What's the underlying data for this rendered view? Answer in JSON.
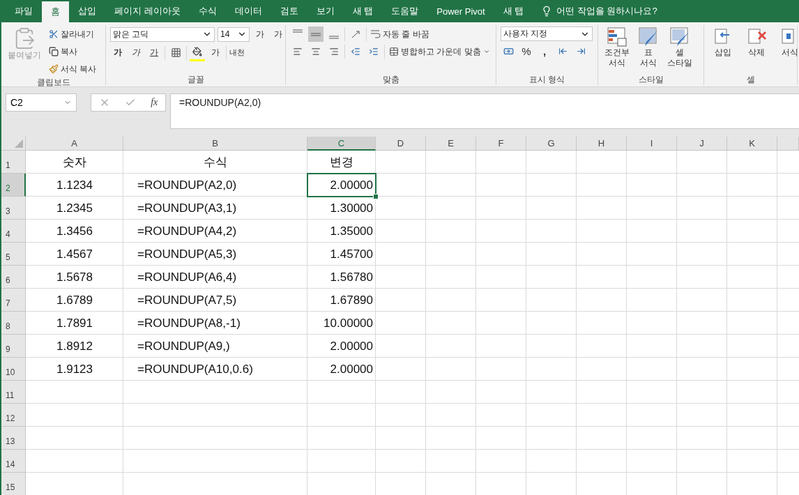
{
  "tabs": [
    {
      "label": "파일",
      "selected": false
    },
    {
      "label": "홈",
      "selected": true
    },
    {
      "label": "삽입",
      "selected": false
    },
    {
      "label": "페이지 레이아웃",
      "selected": false
    },
    {
      "label": "수식",
      "selected": false
    },
    {
      "label": "데이터",
      "selected": false
    },
    {
      "label": "검토",
      "selected": false
    },
    {
      "label": "보기",
      "selected": false
    },
    {
      "label": "새 탭",
      "selected": false
    },
    {
      "label": "도움말",
      "selected": false
    },
    {
      "label": "Power Pivot",
      "selected": false
    },
    {
      "label": "새 탭",
      "selected": false
    }
  ],
  "tell_me": "어떤 작업을 원하시나요?",
  "clipboard": {
    "label": "클립보드",
    "paste": "붙여넣기",
    "paste_disabled": true,
    "cut": "잘라내기",
    "copy": "복사",
    "format_painter": "서식 복사"
  },
  "font": {
    "label": "글꼴",
    "name": "맑은 고딕",
    "size": "14",
    "grow": "가",
    "shrink": "가",
    "bold": "가",
    "italic": "가",
    "underline": "가",
    "font_color": "가",
    "phonetic": "내천"
  },
  "alignment": {
    "label": "맞춤",
    "vertical": [
      {
        "selected": false
      },
      {
        "selected": true
      },
      {
        "selected": false
      }
    ],
    "wrap": "자동 줄 바꿈",
    "merge": "병합하고 가운데 맞춤"
  },
  "number": {
    "label": "표시 형식",
    "format": "사용자 지정",
    "percent": "%",
    "comma": ","
  },
  "styles": {
    "label": "스타일",
    "items": [
      {
        "line1": "조건부",
        "line2": "서식"
      },
      {
        "line1": "표",
        "line2": "서식"
      },
      {
        "line1": "셀",
        "line2": "스타일"
      }
    ]
  },
  "cells": {
    "label": "셀",
    "items": [
      "삽입",
      "삭제",
      "서식"
    ]
  },
  "formula_bar": {
    "name_box": "C2",
    "fx": "fx",
    "formula": "=ROUNDUP(A2,0)"
  },
  "grid": {
    "columns": [
      {
        "label": "A",
        "selected": false
      },
      {
        "label": "B",
        "selected": false
      },
      {
        "label": "C",
        "selected": true
      },
      {
        "label": "D",
        "selected": false
      },
      {
        "label": "E",
        "selected": false
      },
      {
        "label": "F",
        "selected": false
      },
      {
        "label": "G",
        "selected": false
      },
      {
        "label": "H",
        "selected": false
      },
      {
        "label": "I",
        "selected": false
      },
      {
        "label": "J",
        "selected": false
      },
      {
        "label": "K",
        "selected": false
      }
    ],
    "rows": [
      {
        "number": "1",
        "selected": false,
        "cells": [
          "숫자",
          "수식",
          "변경"
        ]
      },
      {
        "number": "2",
        "selected": true,
        "cells": [
          "1.1234",
          "=ROUNDUP(A2,0)",
          "2.00000"
        ]
      },
      {
        "number": "3",
        "selected": false,
        "cells": [
          "1.2345",
          "=ROUNDUP(A3,1)",
          "1.30000"
        ]
      },
      {
        "number": "4",
        "selected": false,
        "cells": [
          "1.3456",
          "=ROUNDUP(A4,2)",
          "1.35000"
        ]
      },
      {
        "number": "5",
        "selected": false,
        "cells": [
          "1.4567",
          "=ROUNDUP(A5,3)",
          "1.45700"
        ]
      },
      {
        "number": "6",
        "selected": false,
        "cells": [
          "1.5678",
          "=ROUNDUP(A6,4)",
          "1.56780"
        ]
      },
      {
        "number": "7",
        "selected": false,
        "cells": [
          "1.6789",
          "=ROUNDUP(A7,5)",
          "1.67890"
        ]
      },
      {
        "number": "8",
        "selected": false,
        "cells": [
          "1.7891",
          "=ROUNDUP(A8,-1)",
          "10.00000"
        ]
      },
      {
        "number": "9",
        "selected": false,
        "cells": [
          "1.8912",
          "=ROUNDUP(A9,)",
          "2.00000"
        ]
      },
      {
        "number": "10",
        "selected": false,
        "cells": [
          "1.9123",
          "=ROUNDUP(A10,0.6)",
          "2.00000"
        ]
      },
      {
        "number": "11",
        "selected": false,
        "cells": []
      },
      {
        "number": "12",
        "selected": false,
        "cells": []
      },
      {
        "number": "13",
        "selected": false,
        "cells": []
      },
      {
        "number": "14",
        "selected": false,
        "cells": []
      },
      {
        "number": "15",
        "selected": false,
        "cells": []
      }
    ]
  }
}
